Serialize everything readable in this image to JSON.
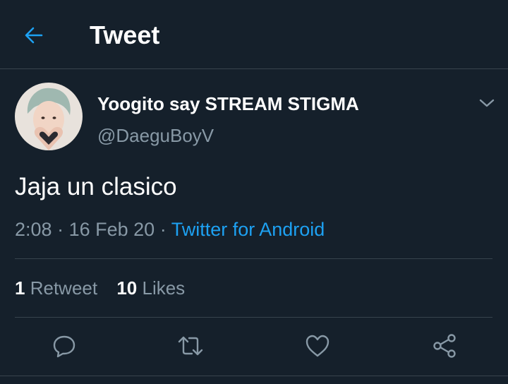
{
  "header": {
    "title": "Tweet",
    "back_icon": "arrow-left-icon"
  },
  "tweet": {
    "author": {
      "display_name": "Yoogito say STREAM STIGMA",
      "username": "@DaeguBoyV"
    },
    "text": "Jaja un clasico",
    "time": "2:08",
    "date": "16 Feb 20",
    "separator": "·",
    "source": "Twitter for Android",
    "stats": {
      "retweets_count": "1",
      "retweets_label": "Retweet",
      "likes_count": "10",
      "likes_label": "Likes"
    }
  },
  "actions": [
    "reply-icon",
    "retweet-icon",
    "like-icon",
    "share-icon"
  ],
  "colors": {
    "background": "#15202b",
    "accent": "#1da1f2",
    "secondary_text": "#8899a6",
    "divider": "#38444d"
  }
}
